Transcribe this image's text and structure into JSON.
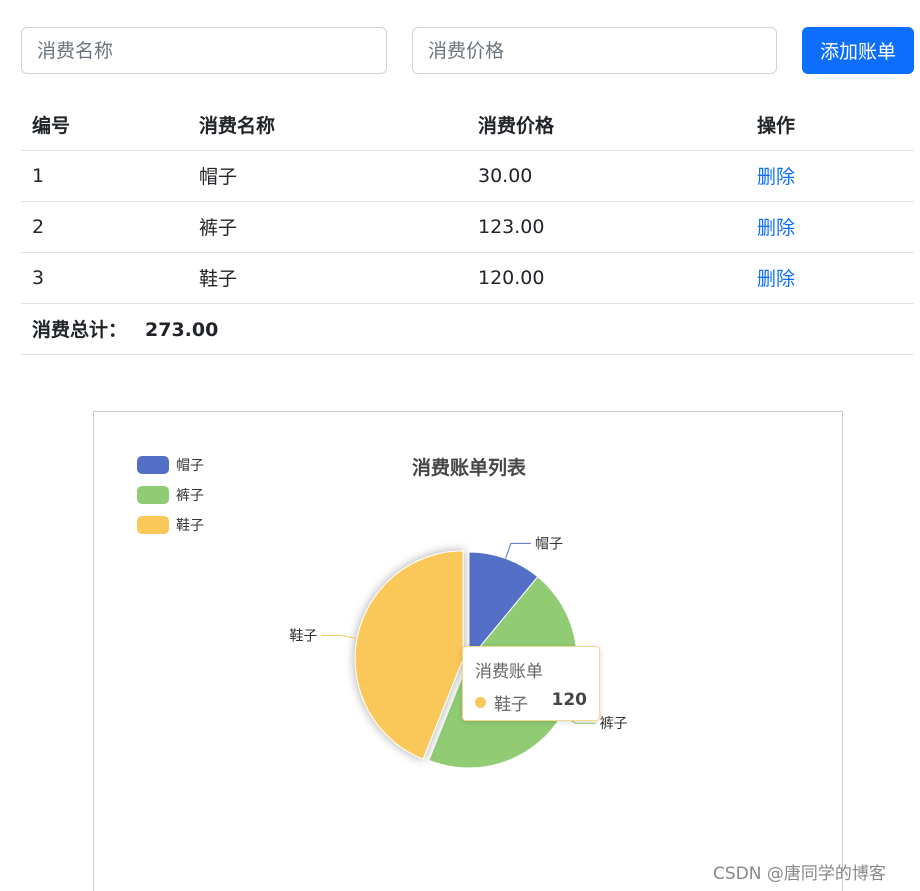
{
  "form": {
    "name_placeholder": "消费名称",
    "price_placeholder": "消费价格",
    "add_label": "添加账单"
  },
  "table": {
    "headers": [
      "编号",
      "消费名称",
      "消费价格",
      "操作"
    ],
    "rows": [
      {
        "id": "1",
        "name": "帽子",
        "price": "30.00",
        "action": "删除"
      },
      {
        "id": "2",
        "name": "裤子",
        "price": "123.00",
        "action": "删除"
      },
      {
        "id": "3",
        "name": "鞋子",
        "price": "120.00",
        "action": "删除"
      }
    ],
    "total_label": "消费总计：",
    "total_value": "273.00"
  },
  "chart_data": {
    "type": "pie",
    "title": "消费账单列表",
    "legend_position": "top-left",
    "series_name": "消费账单",
    "categories": [
      "帽子",
      "裤子",
      "鞋子"
    ],
    "values": [
      30,
      123,
      120
    ],
    "colors": [
      "#5470c6",
      "#91cc75",
      "#fac858"
    ],
    "highlighted": "鞋子"
  },
  "tooltip": {
    "title": "消费账单",
    "name": "鞋子",
    "value": "120"
  },
  "watermark": "CSDN @唐同学的博客"
}
